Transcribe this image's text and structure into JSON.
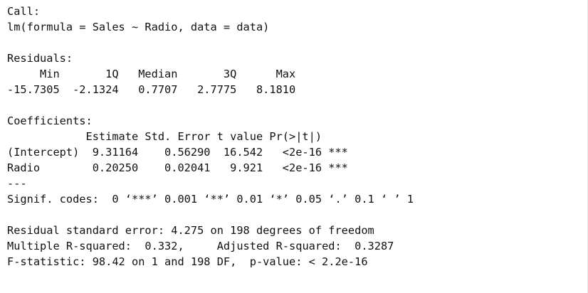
{
  "output": {
    "call_header": "Call:",
    "call_formula": "lm(formula = Sales ~ Radio, data = data)",
    "residuals_header": "Residuals:",
    "residuals_labels": "     Min       1Q   Median       3Q      Max ",
    "residuals_values": "-15.7305  -2.1324   0.7707   2.7775   8.1810 ",
    "coefficients_header": "Coefficients:",
    "coef_table_header": "            Estimate Std. Error t value Pr(>|t|)    ",
    "coef_row_intercept": "(Intercept)  9.31164    0.56290  16.542   <2e-16 ***",
    "coef_row_radio": "Radio        0.20250    0.02041   9.921   <2e-16 ***",
    "separator": "---",
    "signif_codes": "Signif. codes:  0 ‘***’ 0.001 ‘**’ 0.01 ‘*’ 0.05 ‘.’ 0.1 ‘ ’ 1",
    "residual_se": "Residual standard error: 4.275 on 198 degrees of freedom",
    "r_squared": "Multiple R-squared:  0.332,\tAdjusted R-squared:  0.3287 ",
    "f_statistic": "F-statistic: 98.42 on 1 and 198 DF,  p-value: < 2.2e-16"
  }
}
